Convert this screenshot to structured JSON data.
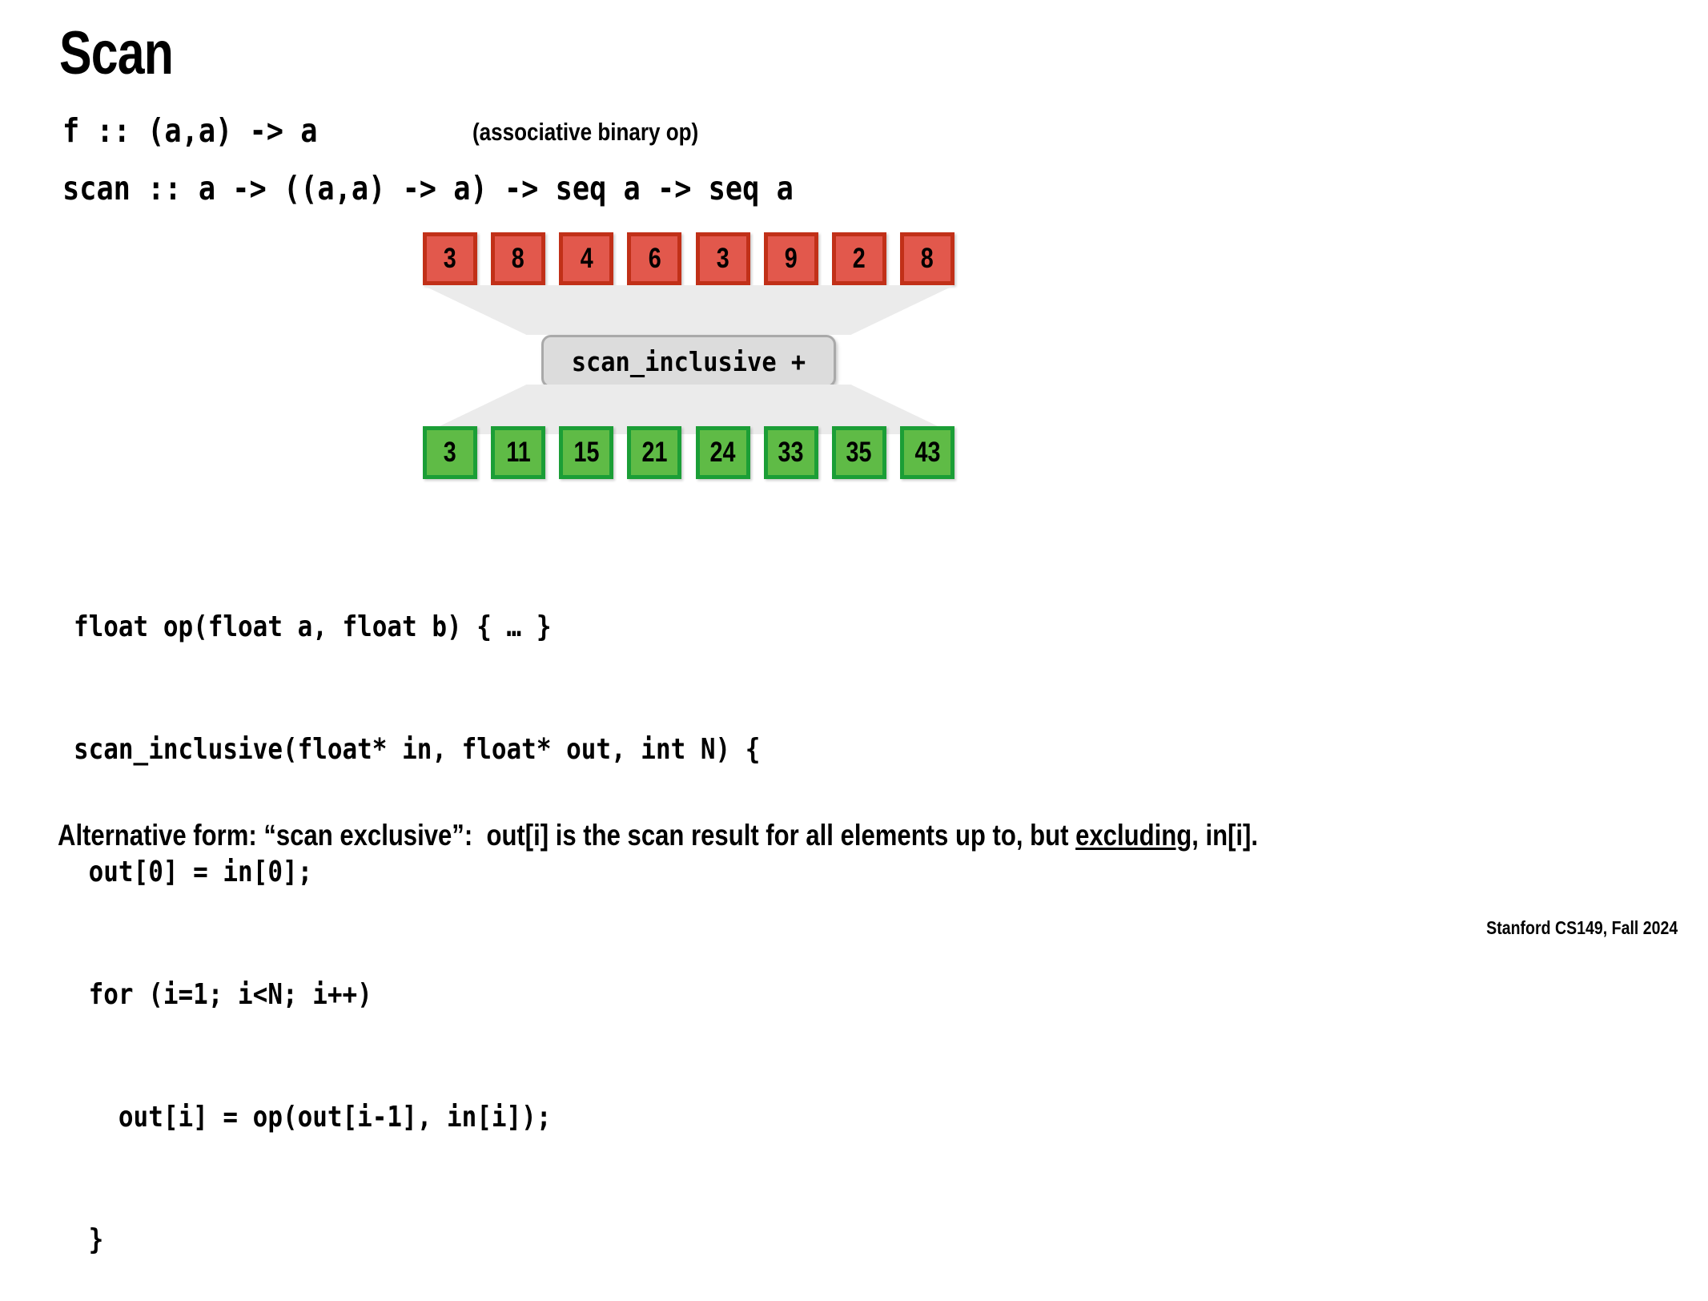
{
  "slide": {
    "title": "Scan",
    "footer": "Stanford CS149, Fall 2024"
  },
  "signatures": {
    "f": "f :: (a,a) -> a",
    "f_note": "(associative binary op)",
    "scan": "scan :: a -> ((a,a) -> a) -> seq a -> seq a"
  },
  "diagram": {
    "operation_label": "scan_inclusive +",
    "input_values": [
      "3",
      "8",
      "4",
      "6",
      "3",
      "9",
      "2",
      "8"
    ],
    "output_values": [
      "3",
      "11",
      "15",
      "21",
      "24",
      "33",
      "35",
      "43"
    ],
    "colors": {
      "input_fill": "#e2584c",
      "input_border": "#c13018",
      "output_fill": "#5fbb46",
      "output_border": "#1b9e36",
      "op_fill": "#dcdcdc",
      "op_border": "#a9a9a9",
      "funnel_fill": "#ebebeb"
    }
  },
  "code": {
    "lines": [
      "float op(float a, float b) { … }",
      "scan_inclusive(float* in, float* out, int N) {",
      " out[0] = in[0];",
      " for (i=1; i<N; i++)",
      "   out[i] = op(out[i-1], in[i]);",
      " }"
    ]
  },
  "bottom_note": {
    "before": "Alternative form: “scan exclusive”:  out[i] is the scan result for all elements up to, but ",
    "underlined": "excluding",
    "after": ", in[i]."
  }
}
